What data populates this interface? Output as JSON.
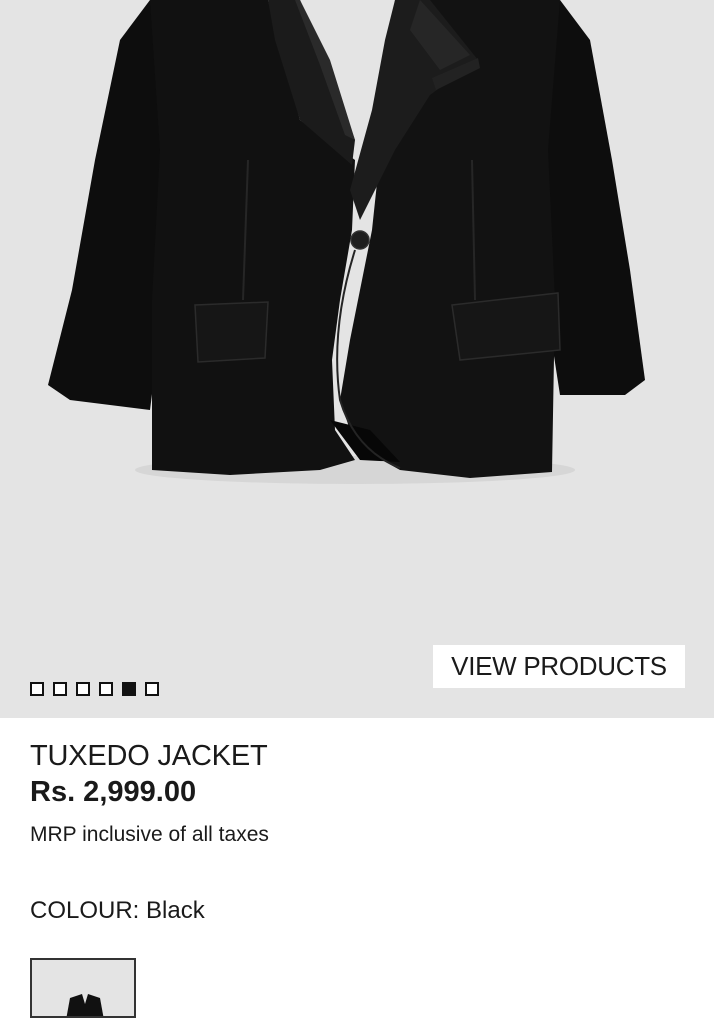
{
  "gallery": {
    "view_products_label": "VIEW PRODUCTS",
    "dots": [
      {
        "active": false
      },
      {
        "active": false
      },
      {
        "active": false
      },
      {
        "active": false
      },
      {
        "active": true
      },
      {
        "active": false
      }
    ],
    "background_color": "#e4e4e4"
  },
  "product": {
    "title": "TUXEDO JACKET",
    "price": "Rs. 2,999.00",
    "tax_note": "MRP inclusive of all taxes",
    "colour_label": "COLOUR: Black",
    "swatches": [
      {
        "icon": "jacket-thumbnail",
        "selected": true
      }
    ]
  }
}
